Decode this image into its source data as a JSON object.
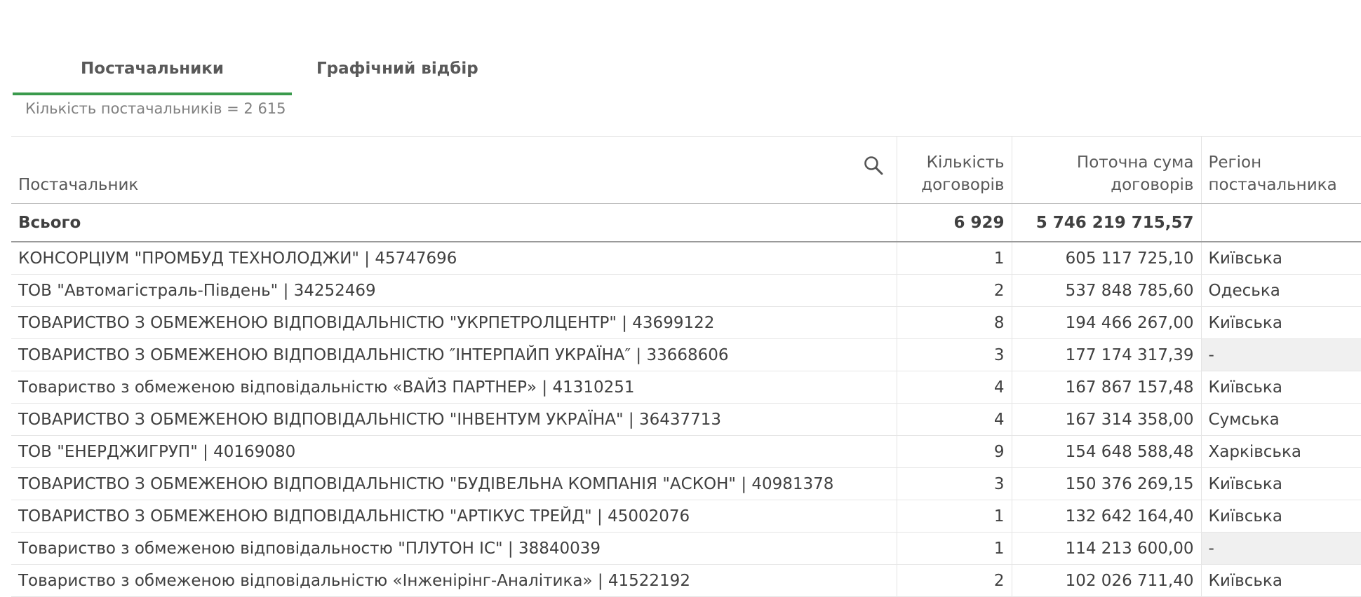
{
  "tabs": [
    {
      "label": "Постачальники",
      "active": true
    },
    {
      "label": "Графічний відбір",
      "active": false
    }
  ],
  "summary_text": "Кількість постачальників = 2 615",
  "table": {
    "headers": {
      "supplier": "Постачальник",
      "contracts_line1": "Кількість",
      "contracts_line2": "договорів",
      "amount_line1": "Поточна сума",
      "amount_line2": "договорів",
      "region_line1": "Регіон",
      "region_line2": "постачальника"
    },
    "total": {
      "label": "Всього",
      "contracts": "6 929",
      "amount": "5 746 219 715,57",
      "region": ""
    },
    "rows": [
      {
        "name": "КОНСОРЦІУМ \"ПРОМБУД ТЕХНОЛОДЖИ\" | 45747696",
        "contracts": "1",
        "amount": "605 117 725,10",
        "region": "Київська"
      },
      {
        "name": "ТОВ \"Автомагістраль-Південь\" | 34252469",
        "contracts": "2",
        "amount": "537 848 785,60",
        "region": "Одеська"
      },
      {
        "name": "ТОВАРИСТВО З ОБМЕЖЕНОЮ ВІДПОВІДАЛЬНІСТЮ \"УКРПЕТРОЛЦЕНТР\" | 43699122",
        "contracts": "8",
        "amount": "194 466 267,00",
        "region": "Київська"
      },
      {
        "name": "ТОВАРИСТВО З ОБМЕЖЕНОЮ ВІДПОВІДАЛЬНІСТЮ ″ІНТЕРПАЙП УКРАЇНА″ | 33668606",
        "contracts": "3",
        "amount": "177 174 317,39",
        "region": "-"
      },
      {
        "name": "Товариство з обмеженою відповідальністю «ВАЙЗ ПАРТНЕР» | 41310251",
        "contracts": "4",
        "amount": "167 867 157,48",
        "region": "Київська"
      },
      {
        "name": "ТОВАРИСТВО З ОБМЕЖЕНОЮ ВІДПОВІДАЛЬНІСТЮ \"ІНВЕНТУМ УКРАЇНА\" | 36437713",
        "contracts": "4",
        "amount": "167 314 358,00",
        "region": "Сумська"
      },
      {
        "name": "ТОВ \"ЕНЕРДЖИГРУП\" | 40169080",
        "contracts": "9",
        "amount": "154 648 588,48",
        "region": "Харківська"
      },
      {
        "name": "ТОВАРИСТВО З ОБМЕЖЕНОЮ ВІДПОВІДАЛЬНІСТЮ \"БУДІВЕЛЬНА КОМПАНІЯ \"АСКОН\" | 40981378",
        "contracts": "3",
        "amount": "150 376 269,15",
        "region": "Київська"
      },
      {
        "name": "ТОВАРИСТВО З ОБМЕЖЕНОЮ ВІДПОВІДАЛЬНІСТЮ \"АРТІКУС ТРЕЙД\" | 45002076",
        "contracts": "1",
        "amount": "132 642 164,40",
        "region": "Київська"
      },
      {
        "name": "Товариство з обмеженою відповідальностю \"ПЛУТОН ІС\" | 38840039",
        "contracts": "1",
        "amount": "114 213 600,00",
        "region": "-"
      },
      {
        "name": "Товариство з обмеженою відповідальністю «Інженірінг-Аналітика» | 41522192",
        "contracts": "2",
        "amount": "102 026 711,40",
        "region": "Київська"
      }
    ]
  }
}
